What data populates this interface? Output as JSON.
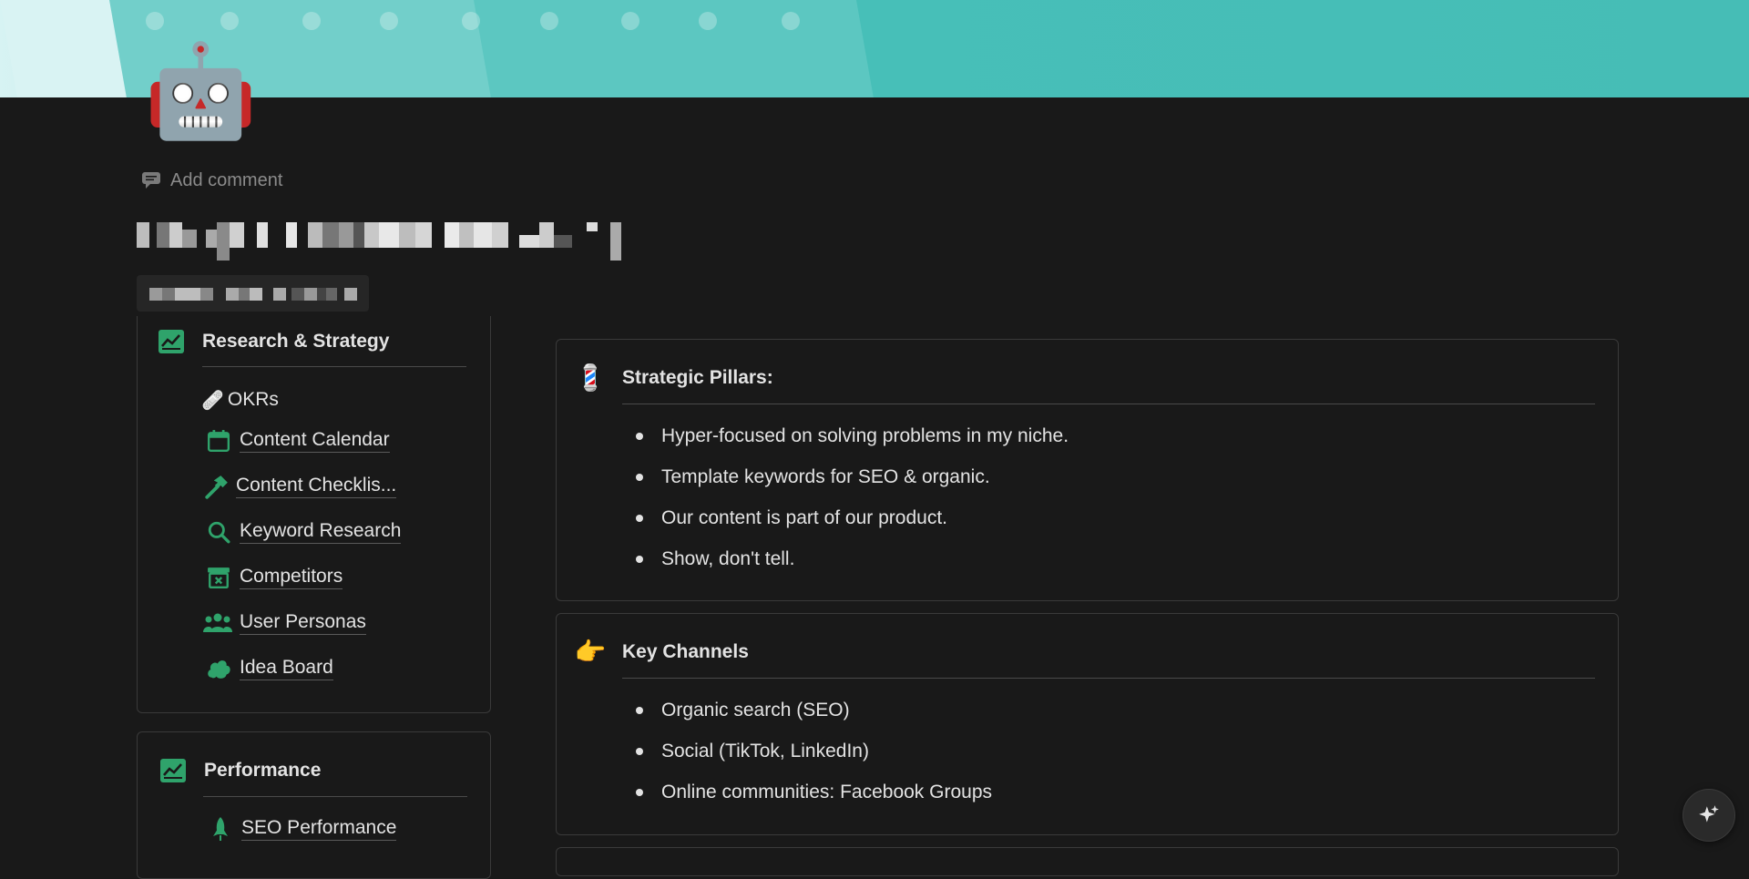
{
  "page": {
    "icon": "robot-emoji",
    "icon_glyph": "🤖",
    "add_comment_label": "Add comment",
    "title_redacted": true,
    "subtitle_redacted": true
  },
  "sidebar": {
    "research": {
      "heading": "Research & Strategy",
      "items": [
        {
          "label": "OKRs",
          "icon": "bandage-emoji",
          "glyph": "🩹"
        },
        {
          "label": "Content Calendar",
          "icon": "calendar-icon"
        },
        {
          "label": "Content Checklis...",
          "icon": "hammer-icon"
        },
        {
          "label": "Keyword Research",
          "icon": "search-icon"
        },
        {
          "label": "Competitors",
          "icon": "archive-x-icon"
        },
        {
          "label": "User Personas",
          "icon": "people-icon"
        },
        {
          "label": "Idea Board",
          "icon": "cloud-icon"
        }
      ]
    },
    "performance": {
      "heading": "Performance",
      "items": [
        {
          "label": "SEO Performance",
          "icon": "rocket-icon"
        }
      ]
    }
  },
  "main": {
    "callouts": [
      {
        "emoji": "barber-pole-emoji",
        "glyph": "💈",
        "heading": "Strategic Pillars:",
        "bullets": [
          "Hyper-focused on solving problems in my niche.",
          "Template keywords for SEO & organic.",
          "Our content is part of our product.",
          "Show, don't tell."
        ]
      },
      {
        "emoji": "pointing-right-emoji",
        "glyph": "👉",
        "heading": "Key Channels",
        "bullets": [
          "Organic search (SEO)",
          "Social (TikTok, LinkedIn)",
          "Online communities: Facebook Groups"
        ]
      }
    ]
  },
  "colors": {
    "background": "#191919",
    "accent_green": "#2fa36b",
    "cover_teal": "#47bfb8",
    "text": "#e3e3e3"
  }
}
